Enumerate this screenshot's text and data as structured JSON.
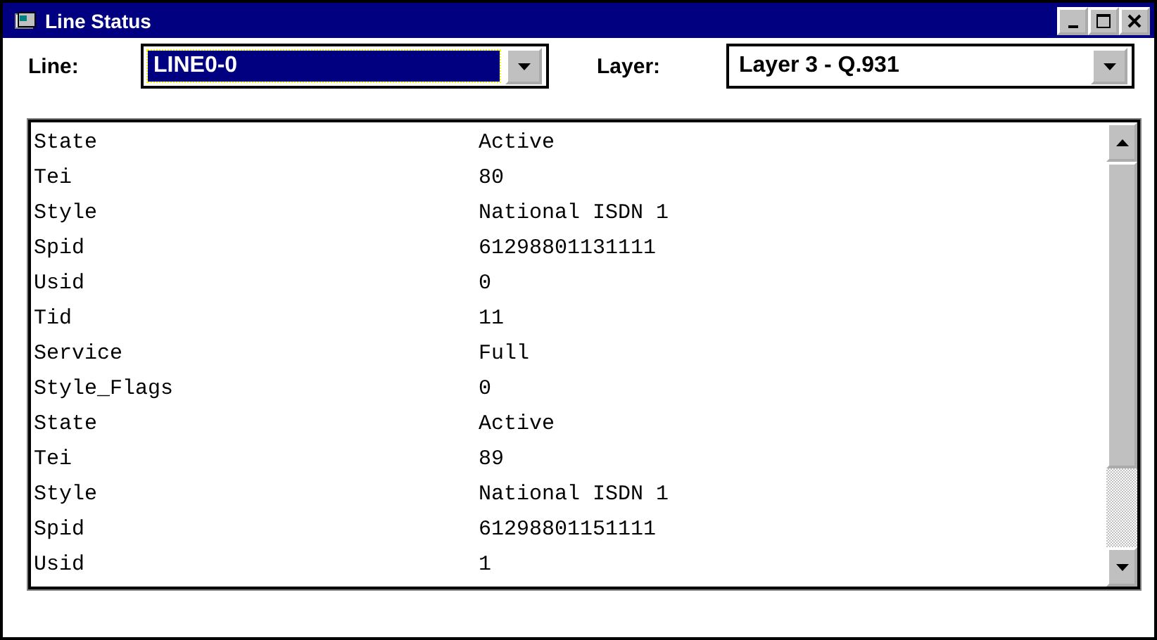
{
  "window": {
    "title": "Line Status"
  },
  "selectors": [
    {
      "label": "Line:",
      "value": "LINE0-0",
      "focused": true
    },
    {
      "label": "Layer:",
      "value": "Layer 3 - Q.931",
      "focused": false
    }
  ],
  "list": {
    "rows": [
      {
        "name": "State",
        "value": "Active"
      },
      {
        "name": "Tei",
        "value": "80"
      },
      {
        "name": "Style",
        "value": "National ISDN 1"
      },
      {
        "name": "Spid",
        "value": "61298801131111"
      },
      {
        "name": "Usid",
        "value": "0"
      },
      {
        "name": "Tid",
        "value": "11"
      },
      {
        "name": "Service",
        "value": "Full"
      },
      {
        "name": "Style_Flags",
        "value": "0"
      },
      {
        "name": "State",
        "value": "Active"
      },
      {
        "name": "Tei",
        "value": "89"
      },
      {
        "name": "Style",
        "value": "National ISDN 1"
      },
      {
        "name": "Spid",
        "value": "61298801151111"
      },
      {
        "name": "Usid",
        "value": "1"
      }
    ]
  }
}
